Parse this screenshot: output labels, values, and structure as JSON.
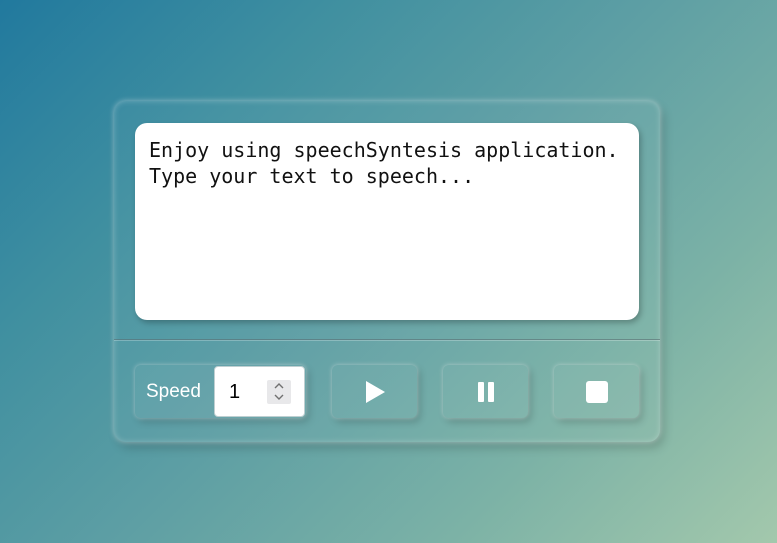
{
  "editor": {
    "text": "Enjoy using speechSyntesis application.\nType your text to speech..."
  },
  "speed": {
    "label": "Speed",
    "value": "1"
  },
  "controls": {
    "play_icon": "play-icon",
    "pause_icon": "pause-icon",
    "stop_icon": "stop-icon"
  },
  "colors": {
    "gradient_start": "#21799e",
    "gradient_end": "#a3c8ac",
    "text_area_bg": "#ffffff",
    "icon_color": "#ffffff"
  }
}
